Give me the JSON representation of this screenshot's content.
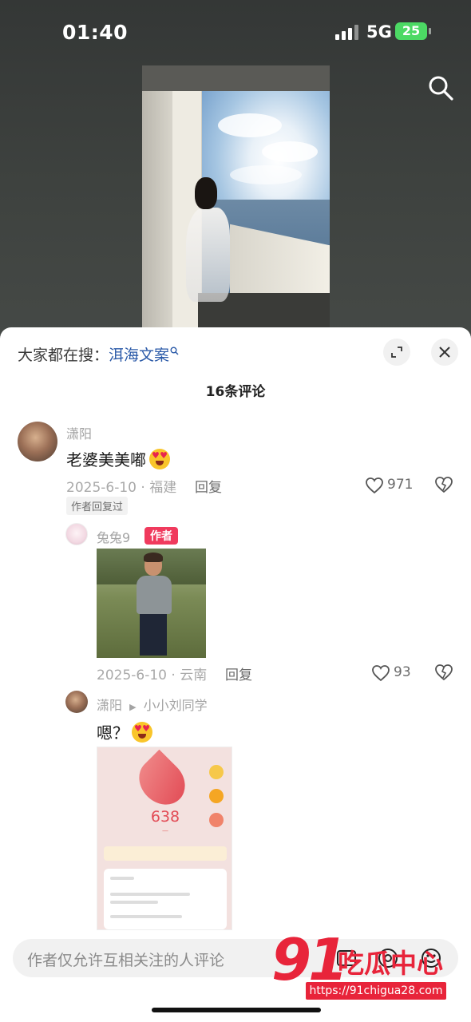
{
  "status_bar": {
    "time": "01:40",
    "network": "5G",
    "battery": "25"
  },
  "sheet": {
    "trending_prefix": "大家都在搜：",
    "trending_keyword": "洱海文案",
    "comment_count_title": "16条评论"
  },
  "comments": [
    {
      "username": "潇阳",
      "text": "老婆美美嘟",
      "date_location": "2025-6-10 · 福建",
      "reply_label": "回复",
      "likes": "971",
      "tag": "作者回复过"
    }
  ],
  "replies": [
    {
      "username": "兔兔9",
      "author_badge": "作者",
      "date_location": "2025-6-10 · 云南",
      "reply_label": "回复",
      "likes": "93"
    },
    {
      "username": "潇阳",
      "reply_to": "小小刘同学",
      "text": "嗯？"
    }
  ],
  "screenshot_card": {
    "number": "638"
  },
  "input": {
    "placeholder": "作者仅允许互相关注的人评论"
  },
  "watermark": {
    "logo": "91",
    "name": "吃瓜中心",
    "url": "https://91chigua28.com"
  },
  "colors": {
    "accent_red": "#f03a5d",
    "link_blue": "#2b5aa8",
    "battery_green": "#4cd964",
    "watermark_red": "#e8243a"
  },
  "icons": [
    "search-icon",
    "expand-icon",
    "close-icon",
    "heart-icon",
    "dislike-heart-icon",
    "emoji-icon",
    "at-icon",
    "image-icon"
  ]
}
